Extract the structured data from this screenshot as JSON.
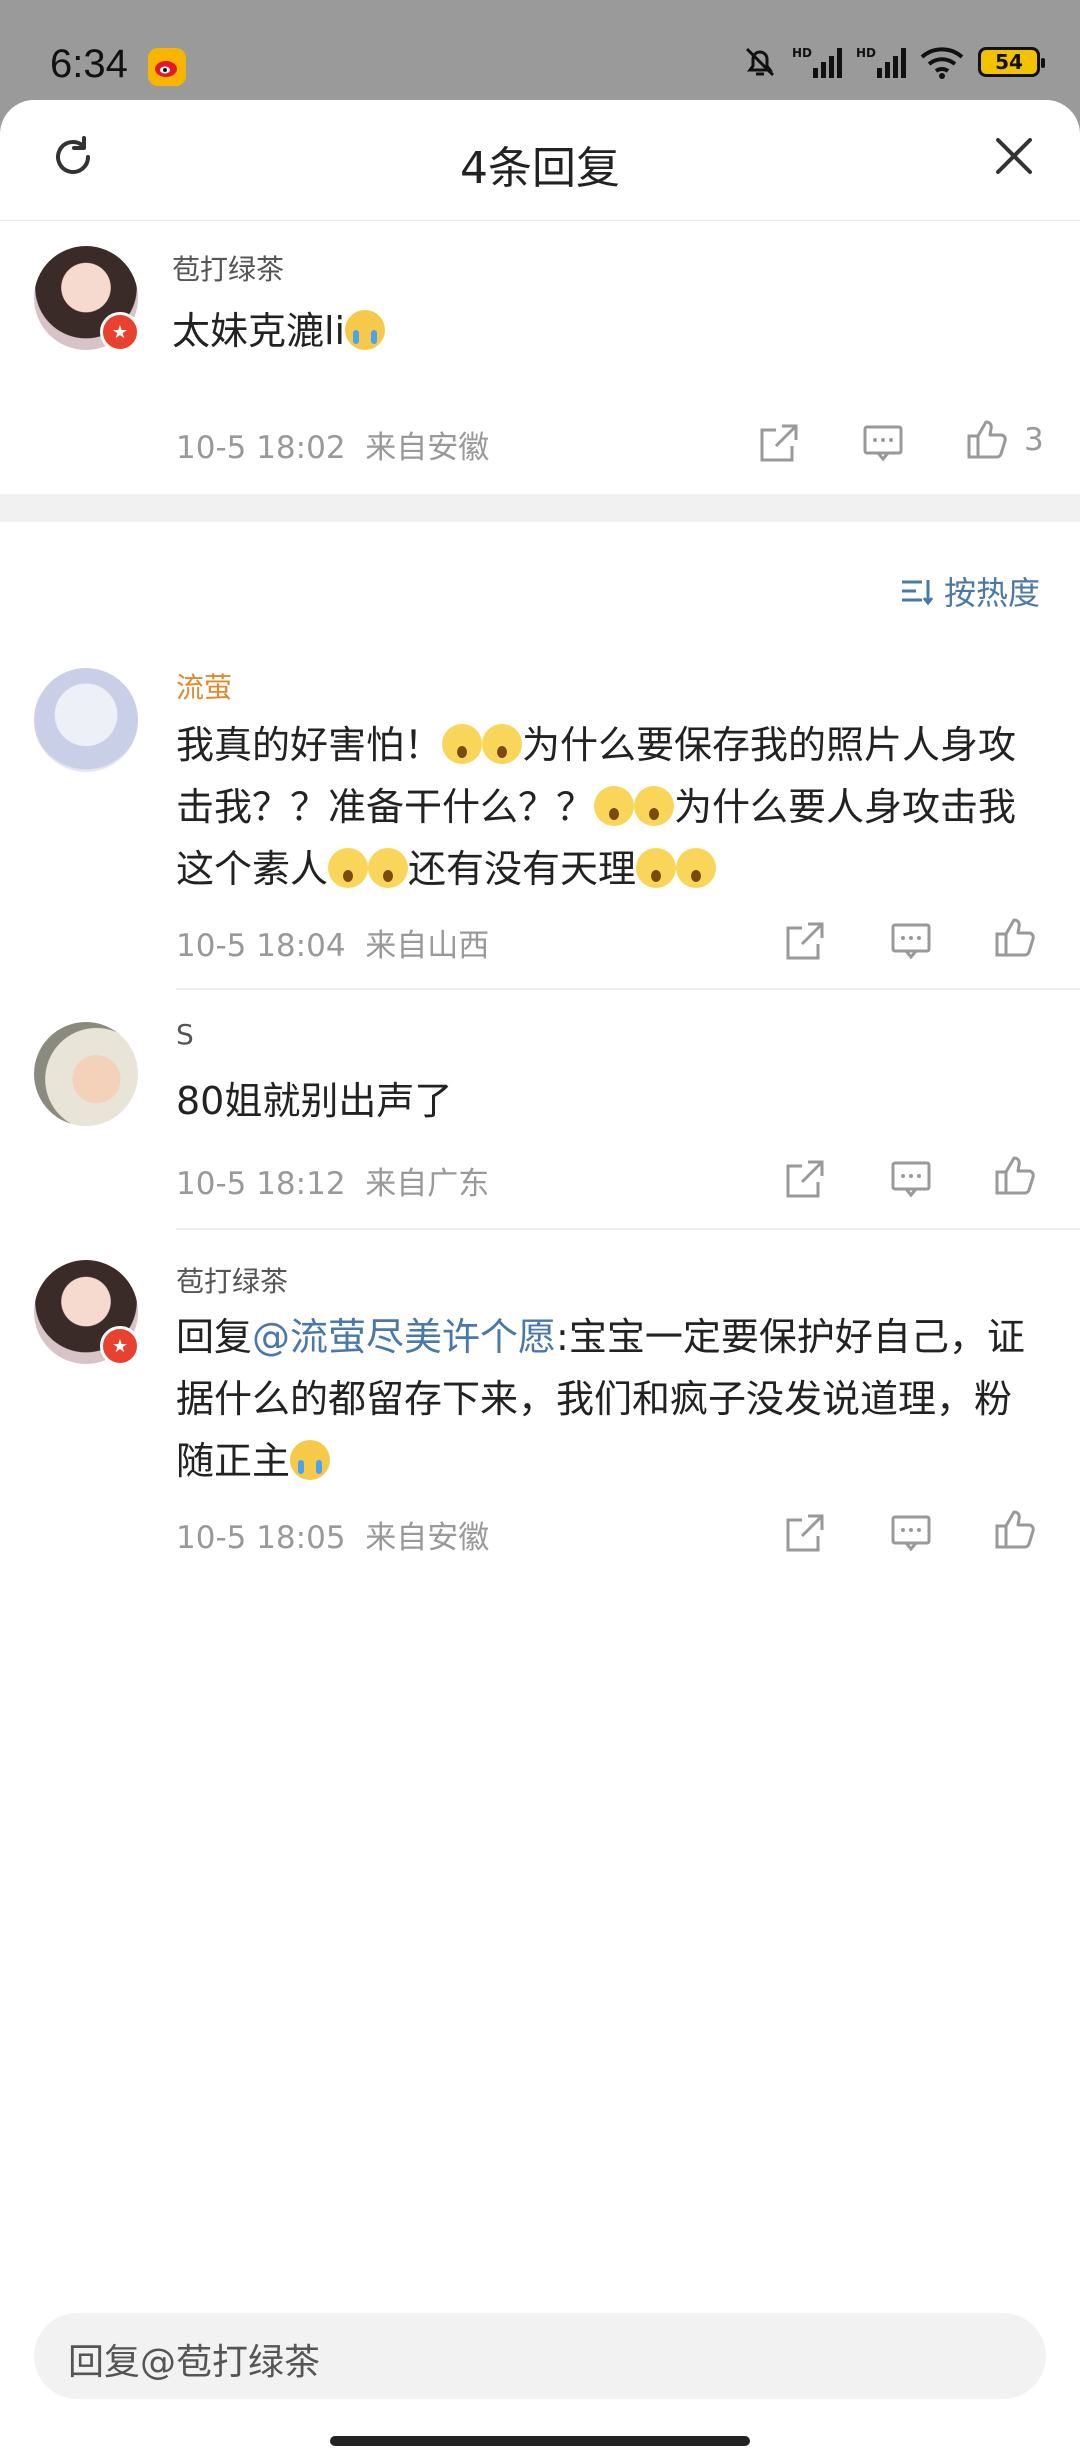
{
  "status": {
    "time": "6:34",
    "battery": "54",
    "hd1": "HD",
    "hd2": "HD"
  },
  "header": {
    "title": "4条回复"
  },
  "main_comment": {
    "username": "苞打绿茶",
    "text": "太妹克漉li",
    "timestamp": "10-5 18:02",
    "location": "来自安徽",
    "likes": "3"
  },
  "sort": {
    "label": "按热度"
  },
  "replies": [
    {
      "username": "流萤",
      "text_a": "我真的好害怕！",
      "text_b": "为什么要保存我的照片人身攻击我？？准备干什么？？",
      "text_c": "为什么要人身攻击我这个素人",
      "text_d": "还有没有天理",
      "timestamp": "10-5 18:04",
      "location": "来自山西"
    },
    {
      "username": "S",
      "text": "80姐就别出声了",
      "timestamp": "10-5 18:12",
      "location": "来自广东"
    },
    {
      "username": "苞打绿茶",
      "reply_prefix": "回复",
      "mention": "@流萤尽美许个愿",
      "text": ":宝宝一定要保护好自己，证据什么的都留存下来，我们和疯子没发说道理，粉随正主",
      "timestamp": "10-5 18:05",
      "location": "来自安徽"
    }
  ],
  "input": {
    "placeholder": "回复@苞打绿茶"
  },
  "colors": {
    "accent": "#4a78a8",
    "username_orange": "#e08a2e",
    "badge": "#e8412f"
  }
}
